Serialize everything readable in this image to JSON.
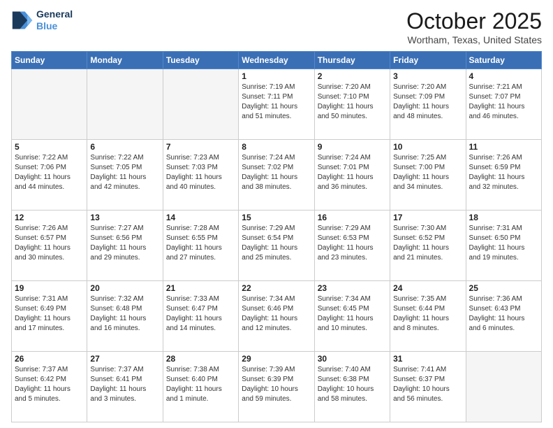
{
  "header": {
    "logo_line1": "General",
    "logo_line2": "Blue",
    "month": "October 2025",
    "location": "Wortham, Texas, United States"
  },
  "days_of_week": [
    "Sunday",
    "Monday",
    "Tuesday",
    "Wednesday",
    "Thursday",
    "Friday",
    "Saturday"
  ],
  "weeks": [
    [
      {
        "day": "",
        "text": ""
      },
      {
        "day": "",
        "text": ""
      },
      {
        "day": "",
        "text": ""
      },
      {
        "day": "1",
        "text": "Sunrise: 7:19 AM\nSunset: 7:11 PM\nDaylight: 11 hours\nand 51 minutes."
      },
      {
        "day": "2",
        "text": "Sunrise: 7:20 AM\nSunset: 7:10 PM\nDaylight: 11 hours\nand 50 minutes."
      },
      {
        "day": "3",
        "text": "Sunrise: 7:20 AM\nSunset: 7:09 PM\nDaylight: 11 hours\nand 48 minutes."
      },
      {
        "day": "4",
        "text": "Sunrise: 7:21 AM\nSunset: 7:07 PM\nDaylight: 11 hours\nand 46 minutes."
      }
    ],
    [
      {
        "day": "5",
        "text": "Sunrise: 7:22 AM\nSunset: 7:06 PM\nDaylight: 11 hours\nand 44 minutes."
      },
      {
        "day": "6",
        "text": "Sunrise: 7:22 AM\nSunset: 7:05 PM\nDaylight: 11 hours\nand 42 minutes."
      },
      {
        "day": "7",
        "text": "Sunrise: 7:23 AM\nSunset: 7:03 PM\nDaylight: 11 hours\nand 40 minutes."
      },
      {
        "day": "8",
        "text": "Sunrise: 7:24 AM\nSunset: 7:02 PM\nDaylight: 11 hours\nand 38 minutes."
      },
      {
        "day": "9",
        "text": "Sunrise: 7:24 AM\nSunset: 7:01 PM\nDaylight: 11 hours\nand 36 minutes."
      },
      {
        "day": "10",
        "text": "Sunrise: 7:25 AM\nSunset: 7:00 PM\nDaylight: 11 hours\nand 34 minutes."
      },
      {
        "day": "11",
        "text": "Sunrise: 7:26 AM\nSunset: 6:59 PM\nDaylight: 11 hours\nand 32 minutes."
      }
    ],
    [
      {
        "day": "12",
        "text": "Sunrise: 7:26 AM\nSunset: 6:57 PM\nDaylight: 11 hours\nand 30 minutes."
      },
      {
        "day": "13",
        "text": "Sunrise: 7:27 AM\nSunset: 6:56 PM\nDaylight: 11 hours\nand 29 minutes."
      },
      {
        "day": "14",
        "text": "Sunrise: 7:28 AM\nSunset: 6:55 PM\nDaylight: 11 hours\nand 27 minutes."
      },
      {
        "day": "15",
        "text": "Sunrise: 7:29 AM\nSunset: 6:54 PM\nDaylight: 11 hours\nand 25 minutes."
      },
      {
        "day": "16",
        "text": "Sunrise: 7:29 AM\nSunset: 6:53 PM\nDaylight: 11 hours\nand 23 minutes."
      },
      {
        "day": "17",
        "text": "Sunrise: 7:30 AM\nSunset: 6:52 PM\nDaylight: 11 hours\nand 21 minutes."
      },
      {
        "day": "18",
        "text": "Sunrise: 7:31 AM\nSunset: 6:50 PM\nDaylight: 11 hours\nand 19 minutes."
      }
    ],
    [
      {
        "day": "19",
        "text": "Sunrise: 7:31 AM\nSunset: 6:49 PM\nDaylight: 11 hours\nand 17 minutes."
      },
      {
        "day": "20",
        "text": "Sunrise: 7:32 AM\nSunset: 6:48 PM\nDaylight: 11 hours\nand 16 minutes."
      },
      {
        "day": "21",
        "text": "Sunrise: 7:33 AM\nSunset: 6:47 PM\nDaylight: 11 hours\nand 14 minutes."
      },
      {
        "day": "22",
        "text": "Sunrise: 7:34 AM\nSunset: 6:46 PM\nDaylight: 11 hours\nand 12 minutes."
      },
      {
        "day": "23",
        "text": "Sunrise: 7:34 AM\nSunset: 6:45 PM\nDaylight: 11 hours\nand 10 minutes."
      },
      {
        "day": "24",
        "text": "Sunrise: 7:35 AM\nSunset: 6:44 PM\nDaylight: 11 hours\nand 8 minutes."
      },
      {
        "day": "25",
        "text": "Sunrise: 7:36 AM\nSunset: 6:43 PM\nDaylight: 11 hours\nand 6 minutes."
      }
    ],
    [
      {
        "day": "26",
        "text": "Sunrise: 7:37 AM\nSunset: 6:42 PM\nDaylight: 11 hours\nand 5 minutes."
      },
      {
        "day": "27",
        "text": "Sunrise: 7:37 AM\nSunset: 6:41 PM\nDaylight: 11 hours\nand 3 minutes."
      },
      {
        "day": "28",
        "text": "Sunrise: 7:38 AM\nSunset: 6:40 PM\nDaylight: 11 hours\nand 1 minute."
      },
      {
        "day": "29",
        "text": "Sunrise: 7:39 AM\nSunset: 6:39 PM\nDaylight: 10 hours\nand 59 minutes."
      },
      {
        "day": "30",
        "text": "Sunrise: 7:40 AM\nSunset: 6:38 PM\nDaylight: 10 hours\nand 58 minutes."
      },
      {
        "day": "31",
        "text": "Sunrise: 7:41 AM\nSunset: 6:37 PM\nDaylight: 10 hours\nand 56 minutes."
      },
      {
        "day": "",
        "text": ""
      }
    ]
  ]
}
